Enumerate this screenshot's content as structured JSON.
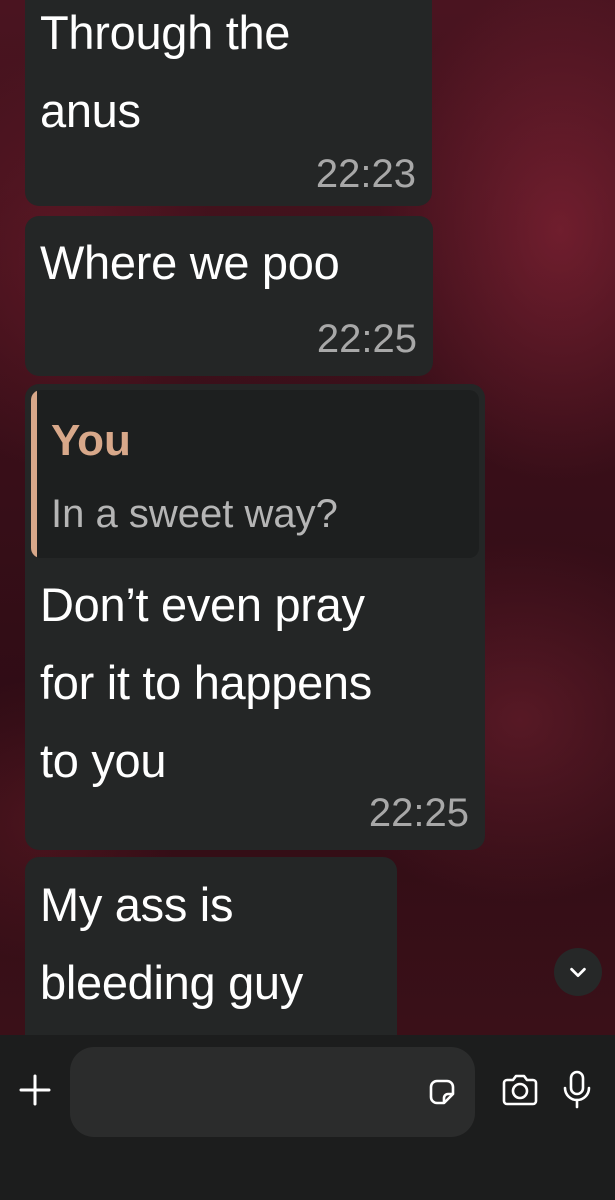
{
  "messages": [
    {
      "text": "Through the\nanus",
      "time": "22:23"
    },
    {
      "text": "Where we poo",
      "time": "22:25"
    },
    {
      "reply_to": {
        "author": "You",
        "text": "In a sweet way?"
      },
      "text": "Don’t even pray\nfor it to happens\nto you",
      "time": "22:25"
    },
    {
      "text": "My ass is\nbleeding guy",
      "time": ""
    }
  ],
  "composer": {
    "input_value": "",
    "icons": {
      "attach": "plus-icon",
      "sticker": "sticker-icon",
      "camera": "camera-icon",
      "mic": "microphone-icon"
    }
  },
  "scroll_button_icon": "chevron-down-icon",
  "colors": {
    "bubble": "#242626",
    "quote_accent": "#d8a88a",
    "timestamp": "#a8a8a8",
    "composer_bg": "#1c1d1d"
  }
}
